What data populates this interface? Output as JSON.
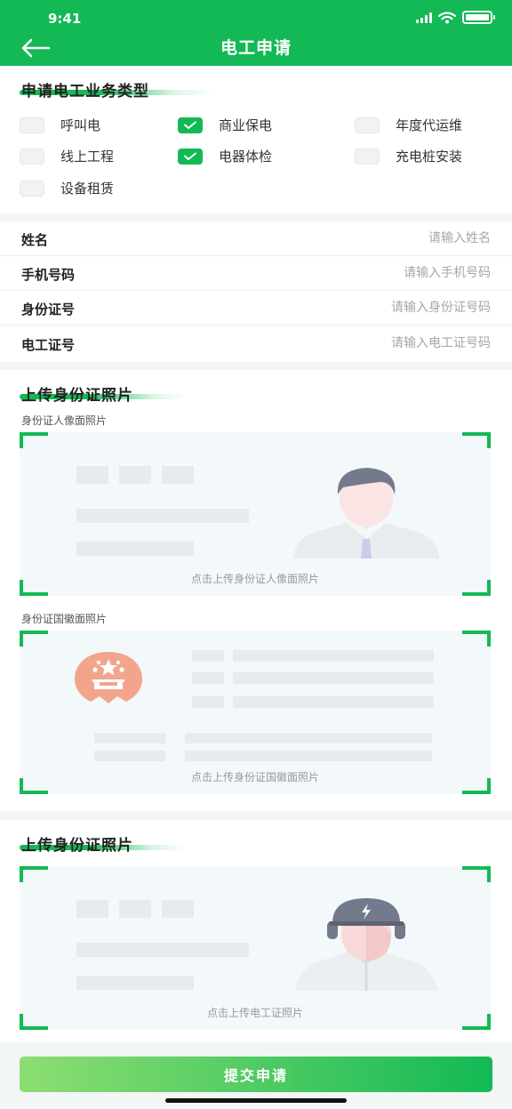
{
  "status_bar": {
    "time": "9:41"
  },
  "header": {
    "title": "电工申请"
  },
  "business": {
    "title": "申请电工业务类型",
    "options": [
      {
        "label": "呼叫电",
        "checked": false
      },
      {
        "label": "商业保电",
        "checked": true
      },
      {
        "label": "年度代运维",
        "checked": false
      },
      {
        "label": "线上工程",
        "checked": false
      },
      {
        "label": "电器体检",
        "checked": true
      },
      {
        "label": "充电桩安装",
        "checked": false
      },
      {
        "label": "设备租赁",
        "checked": false
      }
    ]
  },
  "form": {
    "fields": [
      {
        "label": "姓名",
        "placeholder": "请输入姓名",
        "value": ""
      },
      {
        "label": "手机号码",
        "placeholder": "请输入手机号码",
        "value": ""
      },
      {
        "label": "身份证号",
        "placeholder": "请输入身份证号码",
        "value": ""
      },
      {
        "label": "电工证号",
        "placeholder": "请输入电工证号码",
        "value": ""
      }
    ]
  },
  "id_upload": {
    "title": "上传身份证照片",
    "front_label": "身份证人像面照片",
    "front_hint": "点击上传身份证人像面照片",
    "back_label": "身份证国徽面照片",
    "back_hint": "点击上传身份证国徽面照片"
  },
  "cert_upload": {
    "title": "上传身份证照片",
    "hint": "点击上传电工证照片"
  },
  "submit": {
    "label": "提交申请"
  },
  "colors": {
    "brand": "#13b955",
    "emblem": "#f2a58c",
    "background": "#f2f6f4"
  }
}
